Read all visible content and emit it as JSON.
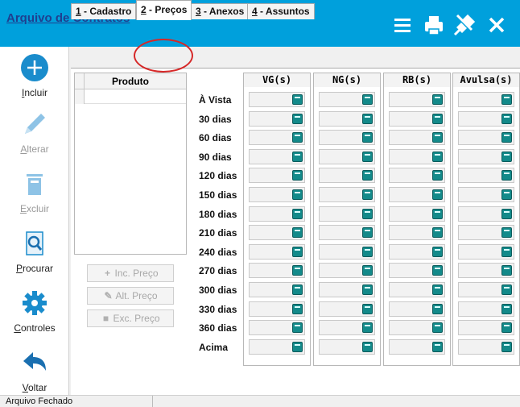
{
  "window": {
    "title": "Arquivo de Contratos",
    "bar_color": "#00a0dc",
    "icons": [
      "menu-icon",
      "print-icon",
      "pin-icon",
      "close-icon"
    ]
  },
  "sidebar": {
    "items": [
      {
        "label": "Incluir",
        "hotkey": "I",
        "rest": "ncluir",
        "icon": "plus-circle-icon",
        "enabled": true
      },
      {
        "label": "Alterar",
        "hotkey": "A",
        "rest": "lterar",
        "icon": "pencil-icon",
        "enabled": false
      },
      {
        "label": "Excluir",
        "hotkey": "E",
        "rest": "xcluir",
        "icon": "trash-icon",
        "enabled": false
      },
      {
        "label": "Procurar",
        "hotkey": "P",
        "rest": "rocurar",
        "icon": "search-document-icon",
        "enabled": true
      },
      {
        "label": "Controles",
        "hotkey": "C",
        "rest": "ontroles",
        "icon": "gear-icon",
        "enabled": true
      },
      {
        "label": "Voltar",
        "hotkey": "V",
        "rest": "oltar",
        "icon": "back-arrow-icon",
        "enabled": true
      }
    ]
  },
  "tabs": [
    {
      "num": "1",
      "label": " - Cadastro",
      "active": false
    },
    {
      "num": "2",
      "label": " - Preços",
      "active": true
    },
    {
      "num": "3",
      "label": " - Anexos",
      "active": false
    },
    {
      "num": "4",
      "label": " - Assuntos",
      "active": false
    }
  ],
  "product_table": {
    "header": "Produto",
    "rows": [
      ""
    ]
  },
  "price_buttons": [
    {
      "label": "Inc. Preço",
      "hotkey": "I",
      "icon": "plus-icon"
    },
    {
      "label": "Alt. Preço",
      "hotkey": "A",
      "icon": "edit-icon"
    },
    {
      "label": "Exc. Preço",
      "hotkey": "E",
      "icon": "delete-icon"
    }
  ],
  "price_grid": {
    "columns": [
      "VG(s)",
      "NG(s)",
      "RB(s)",
      "Avulsa(s)"
    ],
    "rows": [
      "À Vista",
      "30 dias",
      "60 dias",
      "90 dias",
      "120 dias",
      "150 dias",
      "180 dias",
      "210 dias",
      "240 dias",
      "270 dias",
      "300 dias",
      "330 dias",
      "360 dias",
      "Acima"
    ],
    "cell_icon": "calculator-icon",
    "cell_icon_color": "#138a8a"
  },
  "status": {
    "text": "Arquivo Fechado"
  },
  "colors": {
    "highlight_ring": "#d62828"
  }
}
